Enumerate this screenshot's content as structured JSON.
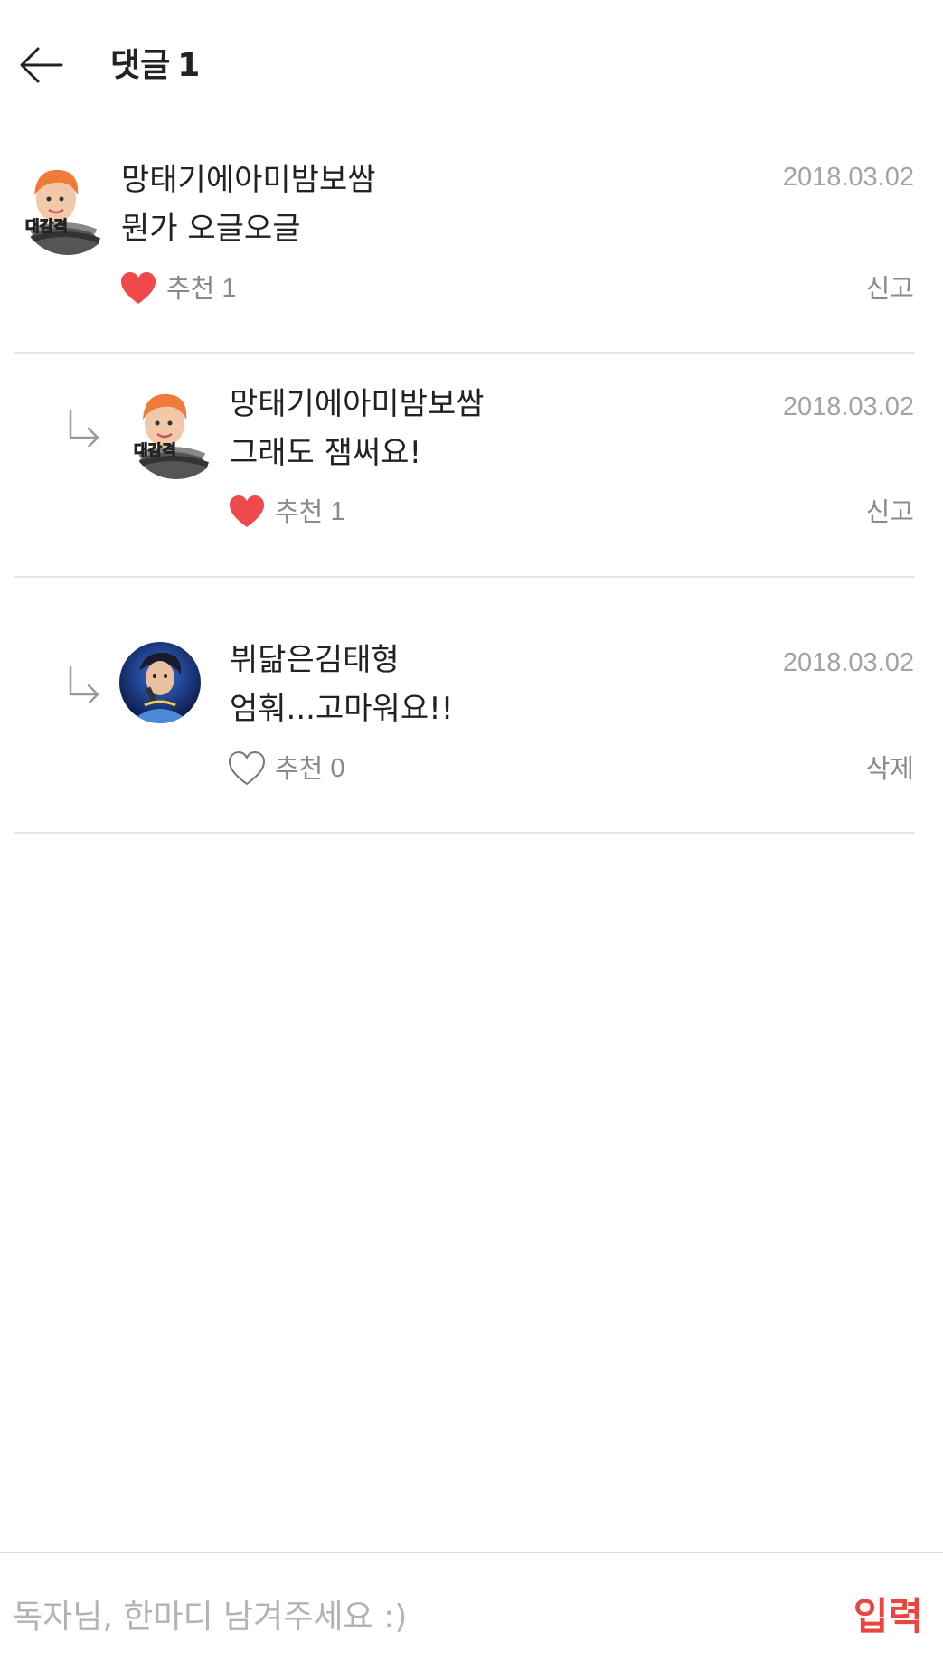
{
  "header": {
    "back_icon": "arrow-left-icon",
    "title": "댓글",
    "count": "1"
  },
  "comments": [
    {
      "is_reply": false,
      "username": "망태기에아미밤보쌈",
      "date": "2018.03.02",
      "text": "뭔가 오글오글",
      "like_label": "추천",
      "like_count": "1",
      "liked": true,
      "action": "신고",
      "avatar_badge": "대감격"
    },
    {
      "is_reply": true,
      "username": "망태기에아미밤보쌈",
      "date": "2018.03.02",
      "text": "그래도 잼써요!",
      "like_label": "추천",
      "like_count": "1",
      "liked": true,
      "action": "신고",
      "avatar_badge": "대감격"
    },
    {
      "is_reply": true,
      "username": "뷔닮은김태형",
      "date": "2018.03.02",
      "text": "엄훠...고마워요!!",
      "like_label": "추천",
      "like_count": "0",
      "liked": false,
      "action": "삭제"
    }
  ],
  "input_bar": {
    "placeholder": "독자님, 한마디 남겨주세요 :)",
    "value": "",
    "submit_label": "입력"
  },
  "colors": {
    "accent": "#e8463f",
    "heart_filled": "#f0494b",
    "date": "#a3a3a3",
    "secondary_text": "#8a8a8a",
    "divider": "#e6e6e6"
  }
}
